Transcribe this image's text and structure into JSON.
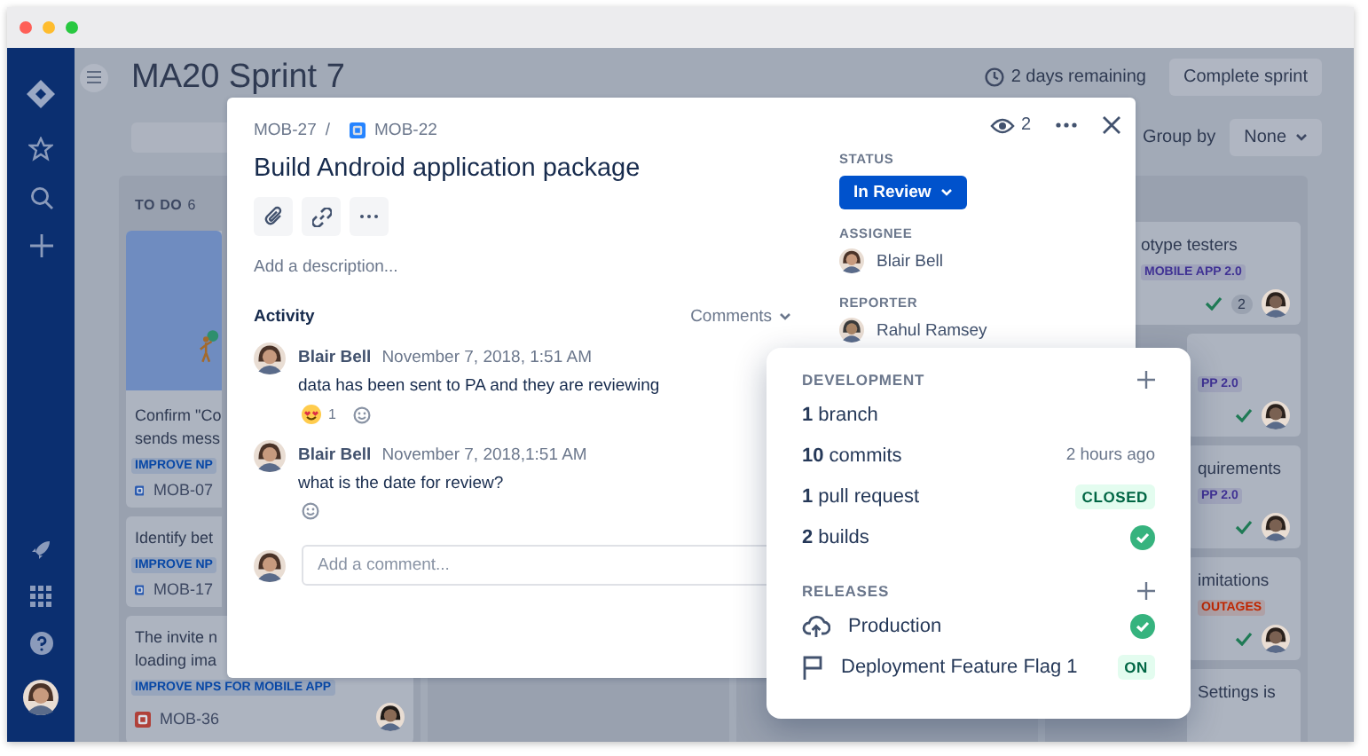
{
  "browser": {
    "dots": [
      {
        "color": "#fe5f57"
      },
      {
        "color": "#febc2e"
      },
      {
        "color": "#28c840"
      }
    ]
  },
  "board": {
    "title": "MA20 Sprint 7",
    "remaining": "2 days remaining",
    "complete_button": "Complete sprint",
    "group_by_label": "Group by",
    "group_by_value": "None",
    "columns": [
      {
        "title": "TO DO",
        "count": "6",
        "cards": [
          {
            "kind": "cover",
            "title": [
              "Confirm \"Co",
              "sends mess"
            ],
            "tag": {
              "text": "IMPROVE NP",
              "color": "#0747a6"
            },
            "key": "MOB-07",
            "color": "#2b5bb0",
            "avatar": false
          },
          {
            "kind": "plain",
            "title": [
              "Identify bet"
            ],
            "tag": {
              "text": "IMPROVE NP",
              "color": "#0747a6"
            },
            "key": "MOB-17",
            "color": "#2b5bb0",
            "avatar": false
          },
          {
            "kind": "plain",
            "title": [
              "The invite n",
              "loading ima"
            ],
            "tag": {
              "text": "IMPROVE NPS FOR MOBILE APP",
              "color": "#0747a6"
            },
            "key": "MOB-36",
            "color": "#b0413a",
            "avatar": true
          }
        ]
      },
      {
        "cards": [
          {
            "title": "otype testers",
            "tag": {
              "text": "MOBILE APP 2.0",
              "color": "#403294"
            },
            "check": true,
            "count": "2",
            "avatar": true
          },
          {
            "tag": {
              "text": "PP 2.0",
              "color": "#403294"
            },
            "check": true,
            "avatar": true
          },
          {
            "title": "quirements",
            "tag": {
              "text": "PP 2.0",
              "color": "#403294"
            },
            "check": true,
            "avatar": true
          },
          {
            "title": "imitations",
            "tag": {
              "text": "OUTAGES",
              "color": "#bf2600"
            },
            "check": true,
            "avatar": true
          },
          {
            "title": "Settings is",
            "check": false,
            "avatar": false
          }
        ]
      }
    ]
  },
  "modal": {
    "parent": "MOB-27",
    "separator": "/",
    "issue_key": "MOB-22",
    "title": "Build Android application package",
    "description_placeholder": "Add a description...",
    "activity_label": "Activity",
    "activity_filter": "Comments",
    "comments": [
      {
        "author": "Blair Bell",
        "time": "November 7, 2018, 1:51 AM",
        "text": "data has been sent to PA and they are reviewing",
        "reactions": [
          {
            "count": "1"
          }
        ]
      },
      {
        "author": "Blair Bell",
        "time": "November 7, 2018,1:51 AM",
        "text": "what is the date for review?"
      }
    ],
    "comment_placeholder": "Add a comment...",
    "watchers": "2",
    "status_label": "STATUS",
    "status": "In Review",
    "assignee_label": "ASSIGNEE",
    "assignee": "Blair Bell",
    "reporter_label": "REPORTER",
    "reporter": "Rahul Ramsey"
  },
  "popover": {
    "development": {
      "label": "DEVELOPMENT",
      "items": [
        {
          "kind": "plain",
          "text": "**1** branch"
        },
        {
          "kind": "time",
          "text": "**10** commits",
          "detail": "2 hours ago"
        },
        {
          "kind": "lozenge",
          "text": "**1** pull request",
          "detail": "CLOSED"
        },
        {
          "kind": "check",
          "text": "**2** builds"
        }
      ]
    },
    "releases": {
      "label": "RELEASES",
      "items": [
        {
          "kind": "deployment",
          "text": "Production"
        },
        {
          "kind": "feature_flag",
          "text": "Deployment Feature Flag 1",
          "detail": "ON"
        }
      ]
    }
  }
}
